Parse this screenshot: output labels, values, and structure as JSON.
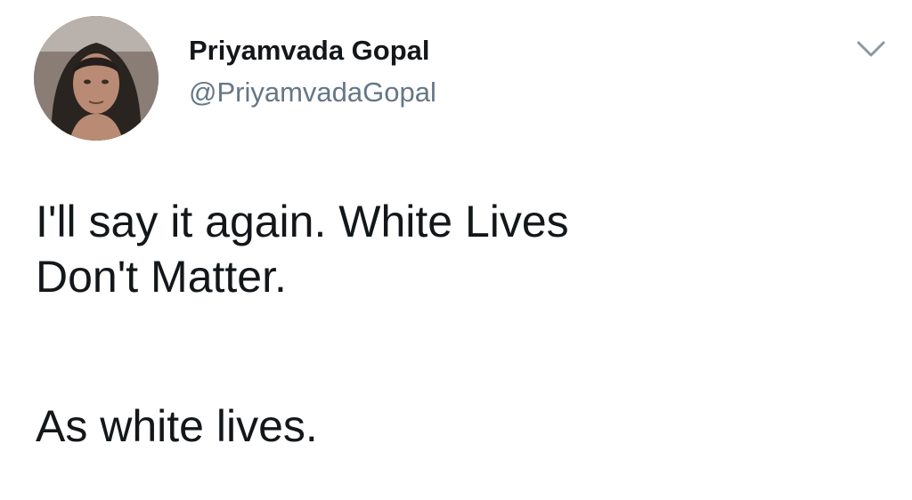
{
  "tweet": {
    "author": {
      "display_name": "Priyamvada Gopal",
      "handle": "@PriyamvadaGopal",
      "avatar_icon": "profile-photo"
    },
    "menu_icon": "chevron-down-icon",
    "text_lines": [
      "I'll say it again. White Lives",
      "Don't Matter.",
      "As white lives."
    ]
  },
  "colors": {
    "name_text": "#14171a",
    "handle_text": "#657786",
    "caret": "#8899a6",
    "background": "#ffffff"
  }
}
